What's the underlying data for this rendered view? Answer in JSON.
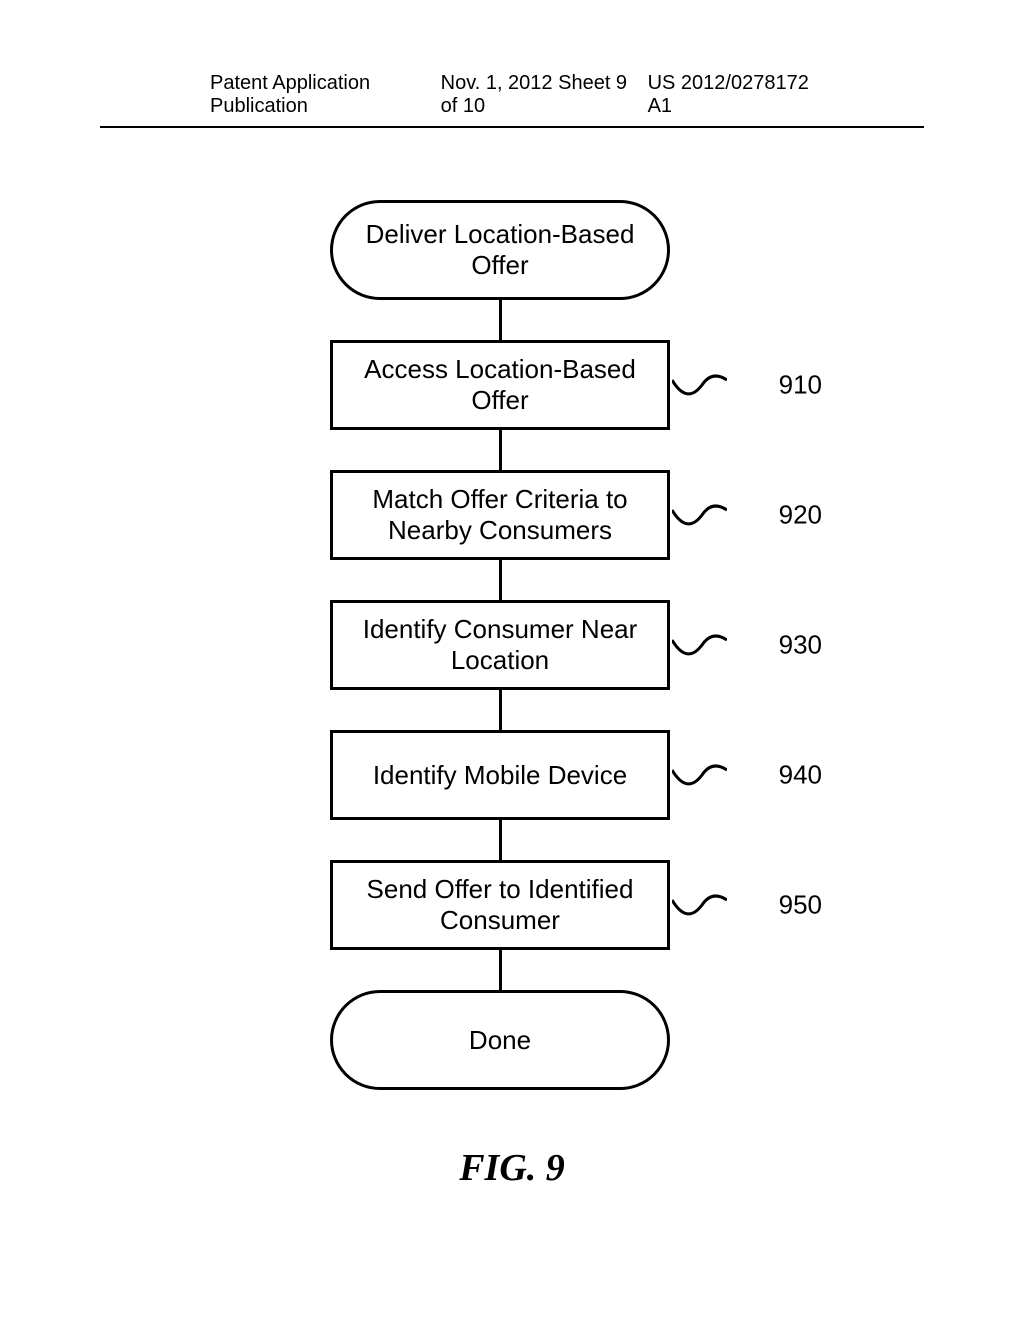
{
  "header": {
    "left": "Patent Application Publication",
    "center": "Nov. 1, 2012  Sheet 9 of 10",
    "right": "US 2012/0278172 A1"
  },
  "flowchart": {
    "start": "Deliver Location-Based\nOffer",
    "steps": [
      {
        "label": "Access Location-Based\nOffer",
        "ref": "910"
      },
      {
        "label": "Match Offer Criteria to\nNearby Consumers",
        "ref": "920"
      },
      {
        "label": "Identify Consumer Near\nLocation",
        "ref": "930"
      },
      {
        "label": "Identify Mobile Device",
        "ref": "940"
      },
      {
        "label": "Send Offer to Identified\nConsumer",
        "ref": "950"
      }
    ],
    "end": "Done"
  },
  "figure_label": "FIG. 9"
}
